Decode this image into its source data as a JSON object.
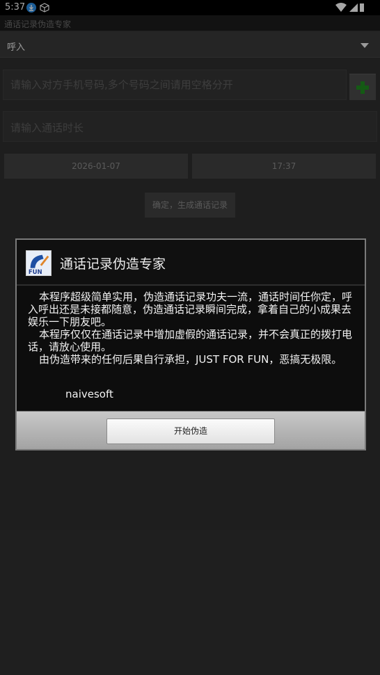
{
  "status_bar": {
    "time": "5:37"
  },
  "app": {
    "title": "通话记录伪造专家"
  },
  "call_type": {
    "selected": "呼入"
  },
  "phone_input": {
    "placeholder": "请输入对方手机号码,多个号码之间请用空格分开"
  },
  "duration_input": {
    "placeholder": "请输入通话时长"
  },
  "date_button": {
    "label": "2026-01-07"
  },
  "time_button": {
    "label": "17:37"
  },
  "confirm_button": {
    "label": "确定，生成通话记录"
  },
  "dialog": {
    "title": "通话记录伪造专家",
    "logo_text": "FUN",
    "paragraphs": [
      "本程序超级简单实用，伪造通话记录功夫一流，通话时间任你定，呼入呼出还是未接都随意，伪造通话记录瞬间完成，拿着自己的小成果去娱乐一下朋友吧。",
      "本程序仅仅在通话记录中增加虚假的通话记录，并不会真正的拨打电话，请放心使用。",
      "由伪造带来的任何后果自行承担，JUST FOR FUN，恶搞无极限。"
    ],
    "signature": "naivesoft",
    "start_button": "开始伪造"
  },
  "colors": {
    "accent_green": "#1f8a1f",
    "background": "#2f2f2f",
    "dialog_bg": "#0d0d0d"
  }
}
